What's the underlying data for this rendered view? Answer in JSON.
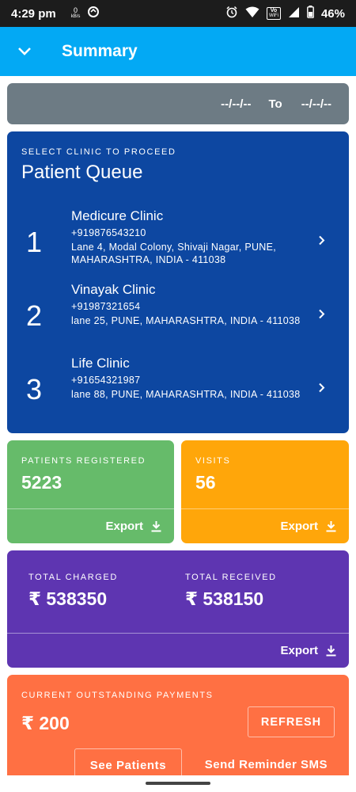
{
  "status_bar": {
    "time": "4:29 pm",
    "speed_top": "0",
    "speed_unit": "kB/s",
    "volte": "Vo",
    "wifi_label": "WiFi",
    "battery_percent": "46%",
    "icons": [
      "data-speed-icon",
      "sync-icon",
      "alarm-icon",
      "wifi-icon",
      "signal-icon",
      "battery-icon"
    ]
  },
  "app_bar": {
    "title": "Summary",
    "icon": "chevron-down-icon",
    "color": "#03a9f4"
  },
  "date_range": {
    "from": "--/--/--",
    "to_label": "To",
    "to": "--/--/--"
  },
  "patient_queue": {
    "overline": "SELECT CLINIC TO PROCEED",
    "title": "Patient Queue",
    "clinics": [
      {
        "index": "1",
        "name": "Medicure Clinic",
        "phone": "+919876543210",
        "address": "Lane 4, Modal Colony, Shivaji Nagar, PUNE, MAHARASHTRA, INDIA - 411038"
      },
      {
        "index": "2",
        "name": "Vinayak Clinic",
        "phone": "+91987321654",
        "address": "lane 25, PUNE, MAHARASHTRA, INDIA - 411038"
      },
      {
        "index": "3",
        "name": "Life Clinic",
        "phone": "+91654321987",
        "address": "lane 88, PUNE, MAHARASHTRA, INDIA - 411038"
      }
    ]
  },
  "patients_registered": {
    "label": "PATIENTS REGISTERED",
    "value": "5223",
    "export_label": "Export",
    "color": "#66bb6a"
  },
  "visits": {
    "label": "VISITS",
    "value": "56",
    "export_label": "Export",
    "color": "#ffa60a"
  },
  "totals": {
    "charged_label": "TOTAL CHARGED",
    "charged_value": "₹ 538350",
    "received_label": "TOTAL RECEIVED",
    "received_value": "₹ 538150",
    "export_label": "Export",
    "color": "#5e35b1"
  },
  "outstanding": {
    "label": "CURRENT OUTSTANDING PAYMENTS",
    "value": "₹ 200",
    "refresh_label": "REFRESH",
    "see_patients_label": "See Patients",
    "send_sms_label": "Send Reminder SMS",
    "color": "#ff7043"
  }
}
